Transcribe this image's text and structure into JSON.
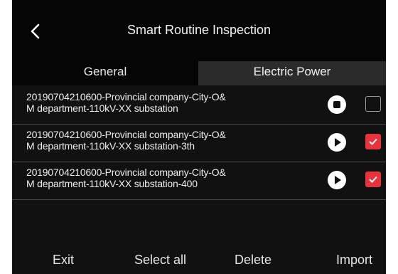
{
  "header": {
    "title": "Smart Routine Inspection",
    "back_icon": "chevron-left-icon"
  },
  "tabs": [
    {
      "label": "General",
      "active": false
    },
    {
      "label": "Electric Power",
      "active": true
    }
  ],
  "rows": [
    {
      "line1": "20190704210600-Provincial company-City-O&",
      "line2": "M department-110kV-XX substation",
      "control": "stop",
      "checked": false
    },
    {
      "line1": "20190704210600-Provincial company-City-O&",
      "line2": "M department-110kV-XX substation-3th",
      "control": "play",
      "checked": true
    },
    {
      "line1": "20190704210600-Provincial company-City-O&",
      "line2": "M department-110kV-XX substation-400",
      "control": "play",
      "checked": true
    }
  ],
  "footer": {
    "exit": "Exit",
    "select_all": "Select all",
    "delete": "Delete",
    "import": "Import"
  },
  "colors": {
    "accent_red": "#e8323c",
    "background": "#111111"
  }
}
